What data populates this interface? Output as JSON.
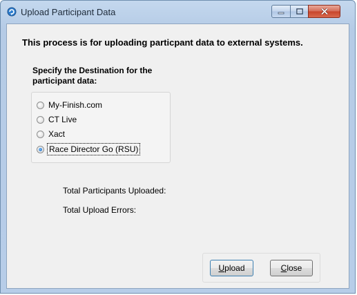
{
  "window": {
    "title": "Upload Participant Data"
  },
  "heading": "This process is for uploading particpant data to external systems.",
  "destination": {
    "label": "Specify the Destination for the participant data:",
    "options": [
      {
        "label": "My-Finish.com",
        "checked": false
      },
      {
        "label": "CT Live",
        "checked": false
      },
      {
        "label": "Xact",
        "checked": false
      },
      {
        "label": "Race Director Go (RSU)",
        "checked": true
      }
    ]
  },
  "stats": {
    "uploaded_label": "Total Participants Uploaded:",
    "errors_label": "Total Upload Errors:"
  },
  "buttons": {
    "upload": {
      "mnemonic": "U",
      "rest": "pload"
    },
    "close": {
      "mnemonic": "C",
      "rest": "lose"
    }
  },
  "colors": {
    "frame": "#b7cde8",
    "client": "#f0f0f0",
    "close_button": "#c7442a"
  }
}
